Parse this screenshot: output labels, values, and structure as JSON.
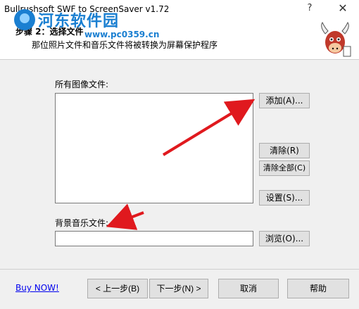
{
  "window": {
    "title": "Bullrushsoft SWF to ScreenSaver v1.72",
    "help_glyph": "?",
    "close_glyph": "✕"
  },
  "watermark": {
    "text": "河东软件园",
    "url": "www.pc0359.cn"
  },
  "header": {
    "step_title": "步骤 2：选择文件",
    "step_desc": "那位照片文件和音乐文件将被转换为屏幕保护程序"
  },
  "images": {
    "label": "所有图像文件:",
    "add_label": "添加(A)...",
    "clear_label": "清除(R)",
    "clear_all_label": "清除全部(C)",
    "settings_label": "设置(S)..."
  },
  "music": {
    "label": "背景音乐文件:",
    "value": "",
    "browse_label": "浏览(O)..."
  },
  "footer": {
    "buy_now": "Buy NOW!",
    "back_label": "< 上一步(B)",
    "next_label": "下一步(N) >",
    "cancel_label": "取消",
    "help_label": "帮助"
  },
  "colors": {
    "arrow": "#e0191e",
    "watermark": "#1a7fd1",
    "link": "#0000ee"
  }
}
